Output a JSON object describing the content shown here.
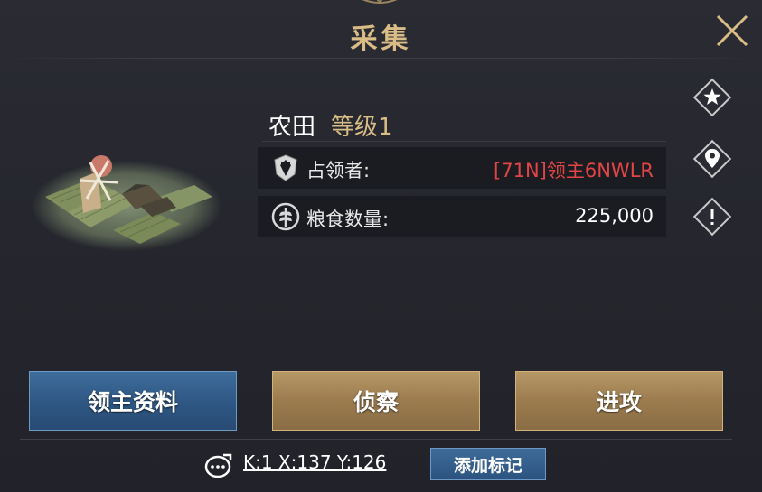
{
  "header": {
    "title": "采集"
  },
  "tile": {
    "name": "农田",
    "level": "等级1",
    "occupant_label": "占领者:",
    "occupant_value": "[71N]领主6NWLR",
    "food_label": "粮食数量:",
    "food_value": "225,000"
  },
  "side_icons": [
    "star-icon",
    "map-pin-icon",
    "exclamation-icon"
  ],
  "buttons": {
    "lord_info": "领主资料",
    "scout": "侦察",
    "attack": "进攻"
  },
  "footer": {
    "coordinates": "K:1 X:137 Y:126",
    "add_mark": "添加标记"
  },
  "colors": {
    "gold": "#d9bc86",
    "occupant_red": "#e24545",
    "blue_button": "#2f5885",
    "gold_button": "#9c7c4f"
  }
}
